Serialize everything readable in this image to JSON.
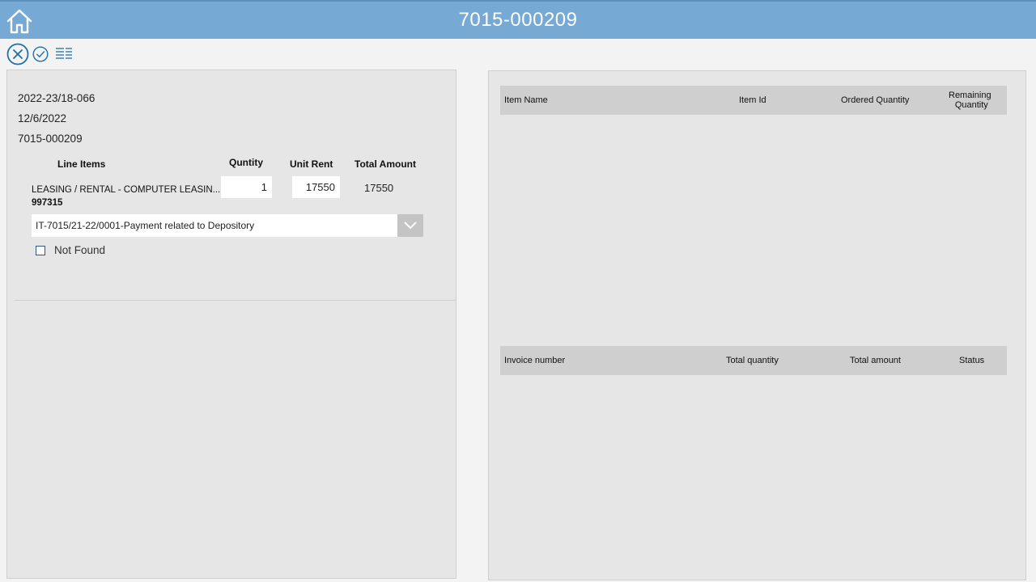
{
  "header": {
    "title": "7015-000209"
  },
  "toolbar": {
    "cancel_icon": "close-circle-icon",
    "submit_icon": "check-circle-icon",
    "details_icon": "list-icon"
  },
  "colors": {
    "header_bg": "#76a9d3",
    "accent": "#1f6fa8",
    "panel_bg": "#e6e6e6"
  },
  "left": {
    "invoice_ref": "2022-23/18-066",
    "date": "12/6/2022",
    "document_no": "7015-000209",
    "columns": {
      "line_items": "Line Items",
      "quantity": "Quntity",
      "unit_rent": "Unit Rent",
      "total_amount": "Total Amount"
    },
    "line_item": {
      "name": "LEASING / RENTAL - COMPUTER LEASIN...",
      "code": "997315",
      "quantity": "1",
      "unit_rent": "17550",
      "total_amount": "17550"
    },
    "dropdown": {
      "selected": "IT-7015/21-22/0001-Payment related to Depository"
    },
    "not_found_label": "Not Found"
  },
  "right": {
    "items_table": {
      "columns": [
        "Item Name",
        "Item Id",
        "Ordered Quantity",
        "Remaining",
        "Quantity"
      ],
      "rows": []
    },
    "invoice_table": {
      "columns": [
        "Invoice  number",
        "Total quantity",
        "Total amount",
        "Status"
      ],
      "rows": []
    }
  }
}
